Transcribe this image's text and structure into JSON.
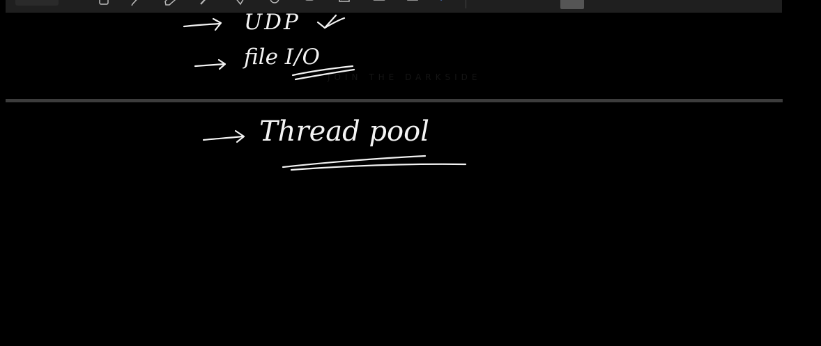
{
  "toolbar": {
    "tools": [
      {
        "icon": "lasso-select-icon"
      },
      {
        "icon": "pen-icon"
      },
      {
        "icon": "eraser-icon"
      },
      {
        "icon": "highlighter-icon"
      },
      {
        "icon": "shapes-icon"
      },
      {
        "icon": "lasso-icon"
      },
      {
        "icon": "sticker-icon"
      },
      {
        "icon": "image-icon"
      },
      {
        "icon": "camera-icon"
      },
      {
        "icon": "text-icon"
      },
      {
        "icon": "laser-pointer-icon"
      }
    ]
  },
  "watermark": {
    "text": "JOIN THE DARKSIDE"
  },
  "notes": {
    "page_top": [
      {
        "text": "UDP",
        "mark": "✓"
      },
      {
        "text_main": "file",
        "text_io": "I/O"
      }
    ],
    "page_bottom": [
      {
        "text": "Thread pool"
      }
    ]
  },
  "colors": {
    "background": "#000000",
    "ink": "#f2f2f2",
    "toolbar": "#1f1f1f",
    "divider": "#3c3c3c"
  }
}
